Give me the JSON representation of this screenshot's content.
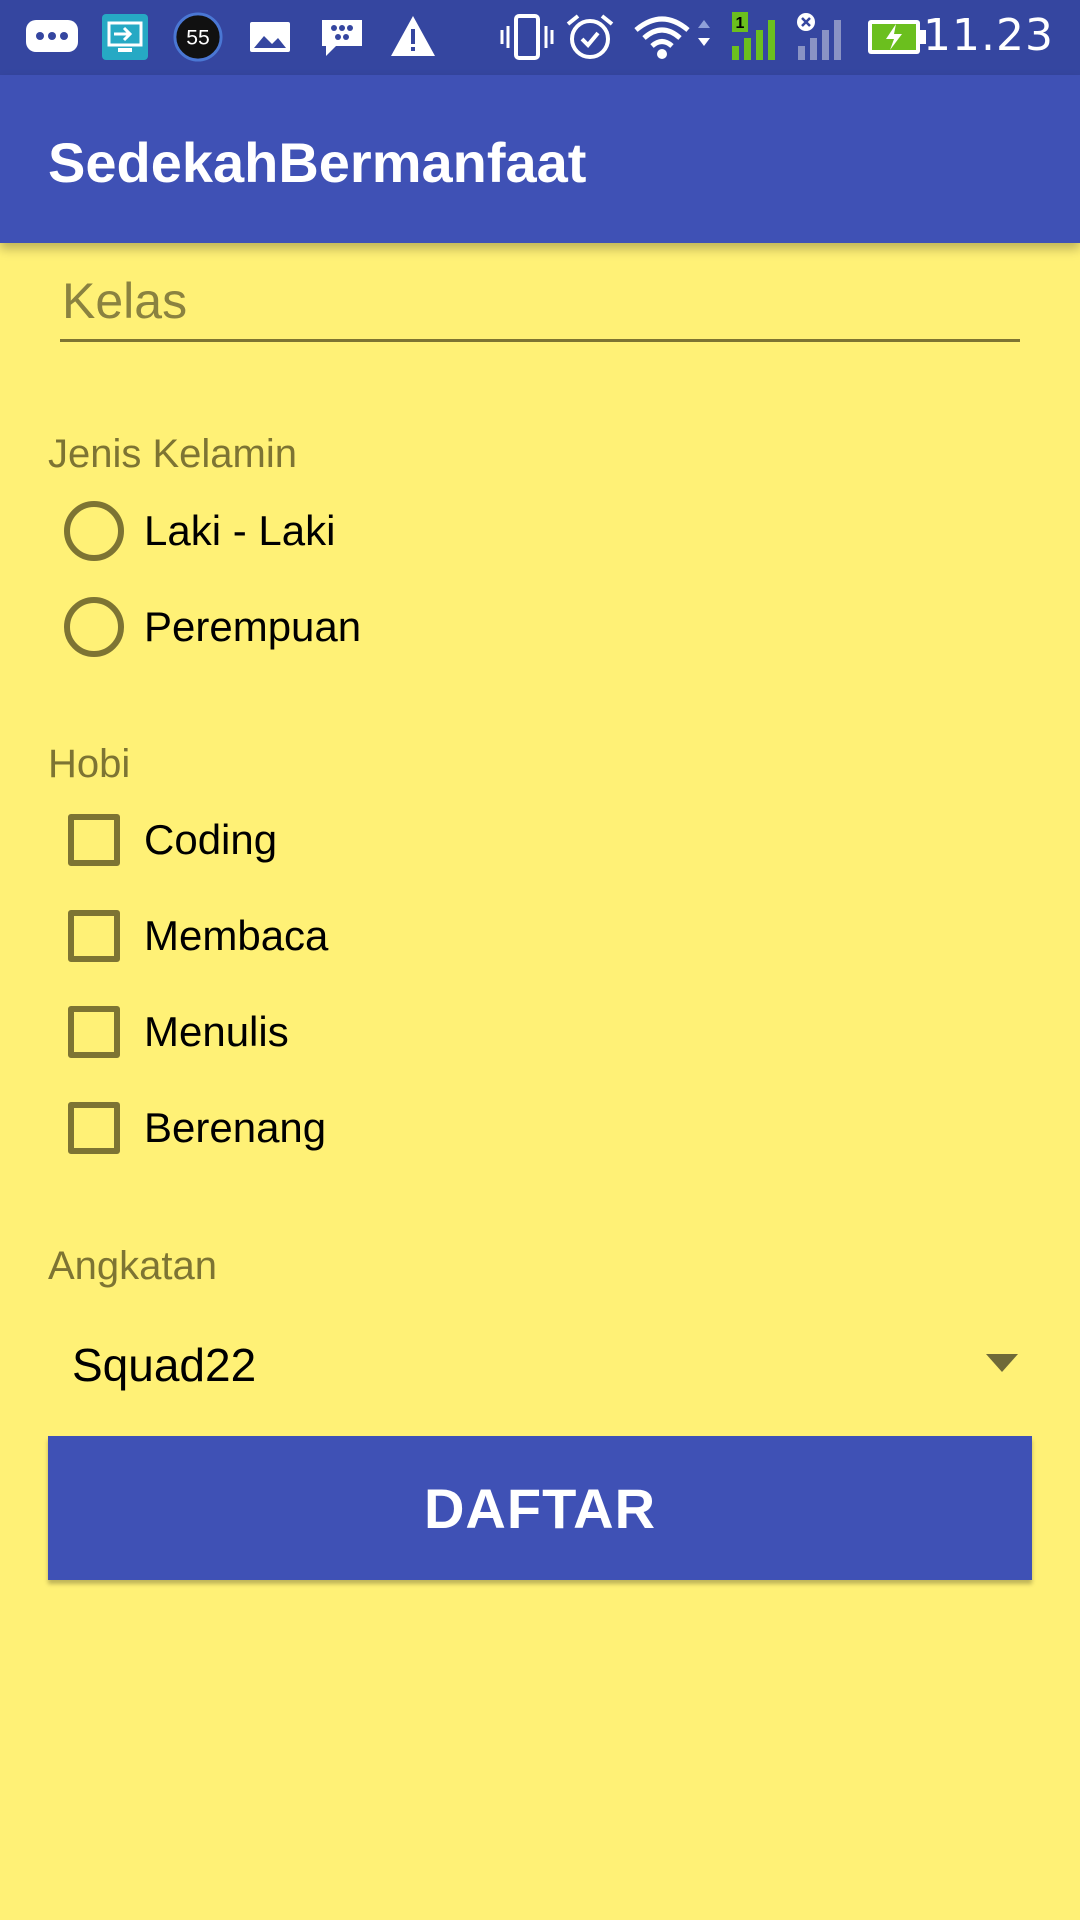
{
  "status_bar": {
    "time": "11.23",
    "badge_count": "55",
    "icons_left": [
      "message-icon",
      "remote-desktop-icon",
      "count-badge-icon",
      "gallery-icon",
      "bbm-icon",
      "warning-icon"
    ],
    "icons_right": [
      "vibrate-icon",
      "alarm-icon",
      "wifi-icon",
      "signal-sim1-icon",
      "signal-sim2-icon",
      "battery-charging-icon"
    ]
  },
  "app_bar": {
    "title": "SedekahBermanfaat"
  },
  "form": {
    "kelas_placeholder": "Kelas",
    "gender_label": "Jenis Kelamin",
    "gender_options": [
      "Laki - Laki",
      "Perempuan"
    ],
    "hobby_label": "Hobi",
    "hobby_options": [
      "Coding",
      "Membaca",
      "Menulis",
      "Berenang"
    ],
    "angkatan_label": "Angkatan",
    "angkatan_value": "Squad22",
    "submit_label": "DAFTAR"
  },
  "colors": {
    "background": "#FFF176",
    "primary": "#3F51B5",
    "status_bar": "#3546A0",
    "control_tint": "#7D7433"
  }
}
